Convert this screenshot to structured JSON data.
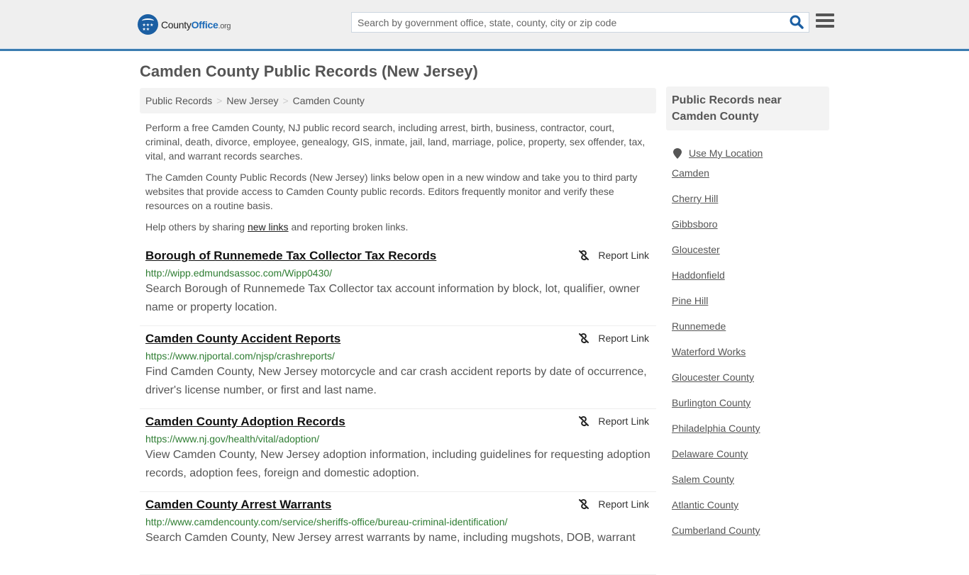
{
  "header": {
    "logo": {
      "name": "County",
      "office": "Office",
      "tld": ".org"
    },
    "search": {
      "placeholder": "Search by government office, state, county, city or zip code",
      "value": ""
    }
  },
  "page_title": "Camden County Public Records (New Jersey)",
  "breadcrumb": [
    "Public Records",
    "New Jersey",
    "Camden County"
  ],
  "breadcrumb_separator": ">",
  "intro": {
    "p1": "Perform a free Camden County, NJ public record search, including arrest, birth, business, contractor, court, criminal, death, divorce, employee, genealogy, GIS, inmate, jail, land, marriage, police, property, sex offender, tax, vital, and warrant records searches.",
    "p2": "The Camden County Public Records (New Jersey) links below open in a new window and take you to third party websites that provide access to Camden County public records. Editors frequently monitor and verify these resources on a routine basis.",
    "p3_before": "Help others by sharing ",
    "p3_link": "new links",
    "p3_after": " and reporting broken links."
  },
  "report_link_label": "Report Link",
  "results": [
    {
      "title": "Borough of Runnemede Tax Collector Tax Records",
      "url": "http://wipp.edmundsassoc.com/Wipp0430/",
      "description": "Search Borough of Runnemede Tax Collector tax account information by block, lot, qualifier, owner name or property location."
    },
    {
      "title": "Camden County Accident Reports",
      "url": "https://www.njportal.com/njsp/crashreports/",
      "description": "Find Camden County, New Jersey motorcycle and car crash accident reports by date of occurrence, driver's license number, or first and last name."
    },
    {
      "title": "Camden County Adoption Records",
      "url": "https://www.nj.gov/health/vital/adoption/",
      "description": "View Camden County, New Jersey adoption information, including guidelines for requesting adoption records, adoption fees, foreign and domestic adoption."
    },
    {
      "title": "Camden County Arrest Warrants",
      "url": "http://www.camdencounty.com/service/sheriffs-office/bureau-criminal-identification/",
      "description": "Search Camden County, New Jersey arrest warrants by name, including mugshots, DOB, warrant"
    }
  ],
  "sidebar": {
    "title": "Public Records near Camden County",
    "use_location": "Use My Location",
    "items": [
      "Camden",
      "Cherry Hill",
      "Gibbsboro",
      "Gloucester",
      "Haddonfield",
      "Pine Hill",
      "Runnemede",
      "Waterford Works",
      "Gloucester County",
      "Burlington County",
      "Philadelphia County",
      "Delaware County",
      "Salem County",
      "Atlantic County",
      "Cumberland County"
    ]
  },
  "colors": {
    "accent": "#3a7cb0",
    "brand": "#1b5fa3",
    "url_green": "#2e7d32"
  }
}
